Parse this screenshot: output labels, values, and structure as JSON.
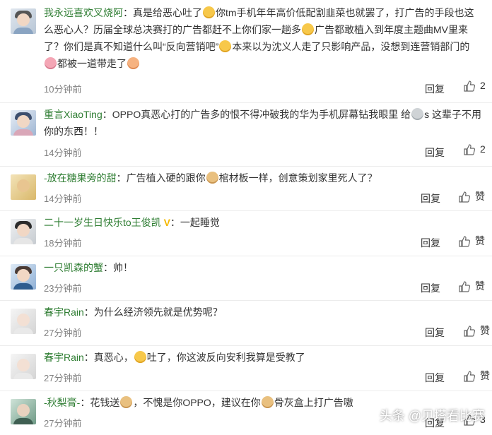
{
  "comments": [
    {
      "user": "我永远喜欢叉烧阿",
      "seg1": "：真是给恶心吐了",
      "seg2": "你tm手机年年高价低配割韭菜也就罢了，打广告的手段也这么恶心人？历届全球总决赛打的广告都赶不上你们家一趟多",
      "seg3": "广告都敢植入到年度主题曲MV里来了？你们是真不知道什么叫“反向营销吧”",
      "seg4": "本来以为沈义人走了只影响产品，没想到连营销部门的",
      "seg5": "都被一道带走了",
      "time": "10分钟前",
      "reply": "回复",
      "likes": "2"
    },
    {
      "user": "重言XiaoTing",
      "seg1": "：OPPO真恶心打的广告多的恨不得冲破我的华为手机屏幕钻我眼里 给",
      "seg2": "s 这辈子不用你的东西！！",
      "time": "14分钟前",
      "reply": "回复",
      "likes": "2"
    },
    {
      "user": "-放在糖果旁的甜",
      "seg1": "：广告植入硬的跟你",
      "seg2": "棺材板一样，创意策划家里死人了？",
      "time": "14分钟前",
      "reply": "回复",
      "likes": "赞"
    },
    {
      "user": "二十一岁生日快乐to王俊凯",
      "vip": "V",
      "seg1": "：一起睡觉",
      "time": "18分钟前",
      "reply": "回复",
      "likes": "赞"
    },
    {
      "user": "一只凯森的蟹",
      "seg1": "：帅！",
      "time": "23分钟前",
      "reply": "回复",
      "likes": "赞"
    },
    {
      "user": "春宇Rain",
      "seg1": "：为什么经济领先就是优势呢？",
      "time": "27分钟前",
      "reply": "回复",
      "likes": "赞"
    },
    {
      "user": "春宇Rain",
      "seg1": "：真恶心，",
      "seg2": "吐了，你这波反向安利我算是受教了",
      "time": "27分钟前",
      "reply": "回复",
      "likes": "赞"
    },
    {
      "user": "-秋梨膏-",
      "seg1": "：花钱送",
      "seg2": "，不愧是你OPPO，建议在你",
      "seg3": "骨灰盒上打广告嗷",
      "time": "27分钟前",
      "reply": "回复",
      "likes": "3"
    }
  ],
  "watermark": "头条 @贝塔看比赛",
  "colors": {
    "username": "#2e7d32",
    "text": "#333333",
    "time": "#808080"
  }
}
